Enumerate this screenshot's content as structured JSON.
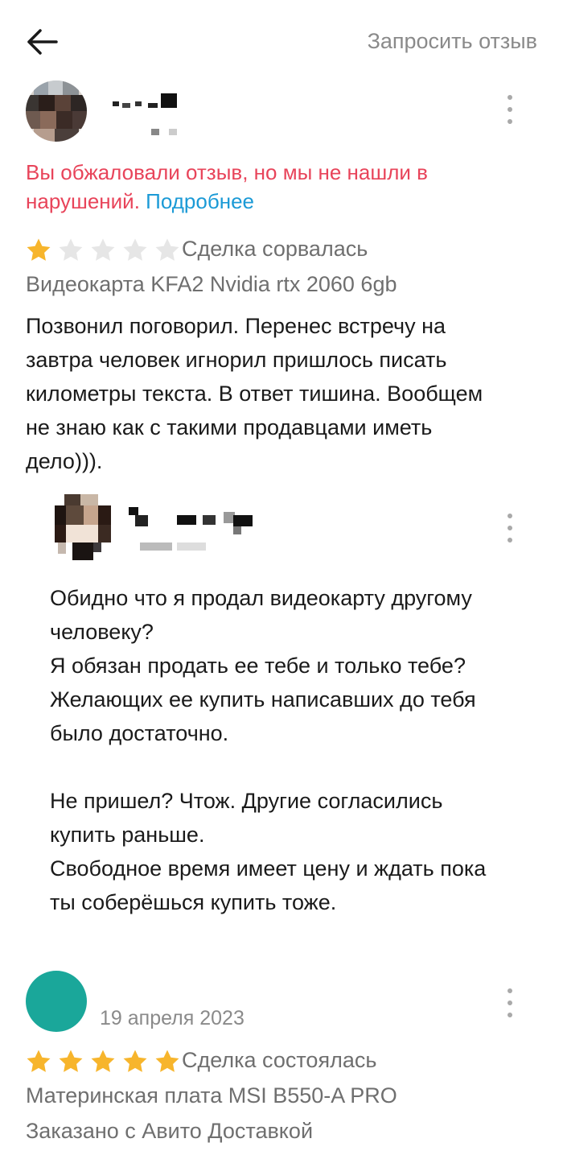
{
  "header": {
    "action_label": "Запросить отзыв"
  },
  "review1": {
    "notice_text": "Вы обжаловали отзыв, но мы не нашли в нарушений.",
    "notice_link": "Подробнее",
    "rating": 1,
    "status": "Сделка сорвалась",
    "product": "Видеокарта KFA2 Nvidia rtx 2060 6gb",
    "text": "Позвонил поговорил. Перенес встречу на\nзавтра человек игнорил пришлось писать\nкилометры текста. В ответ тишина.  Вообщем\nне знаю как с такими продавцами иметь\nдело))).",
    "reply_text": "Обидно что я продал видеокарту другому\nчеловеку?\nЯ обязан продать ее тебе и только тебе?\nЖелающих ее купить написавших до тебя\nбыло достаточно.\n\nНе пришел? Чтож. Другие согласились\nкупить раньше.\nСвободное время имеет цену и ждать пока\nты соберёшься купить тоже."
  },
  "review2": {
    "date": "19 апреля 2023",
    "rating": 5,
    "status": "Сделка состоялась",
    "product": "Материнская плата MSI B550-A PRO",
    "delivery": "Заказано с Авито Доставкой",
    "avatar_color": "#1aa79a"
  },
  "colors": {
    "star_filled": "#f7b52c",
    "star_empty": "#e6e6e6",
    "notice": "#e8445a",
    "link": "#1b9ad6"
  },
  "icons": {
    "back": "arrow-left-icon",
    "menu": "more-vertical-icon",
    "star": "star-icon"
  }
}
